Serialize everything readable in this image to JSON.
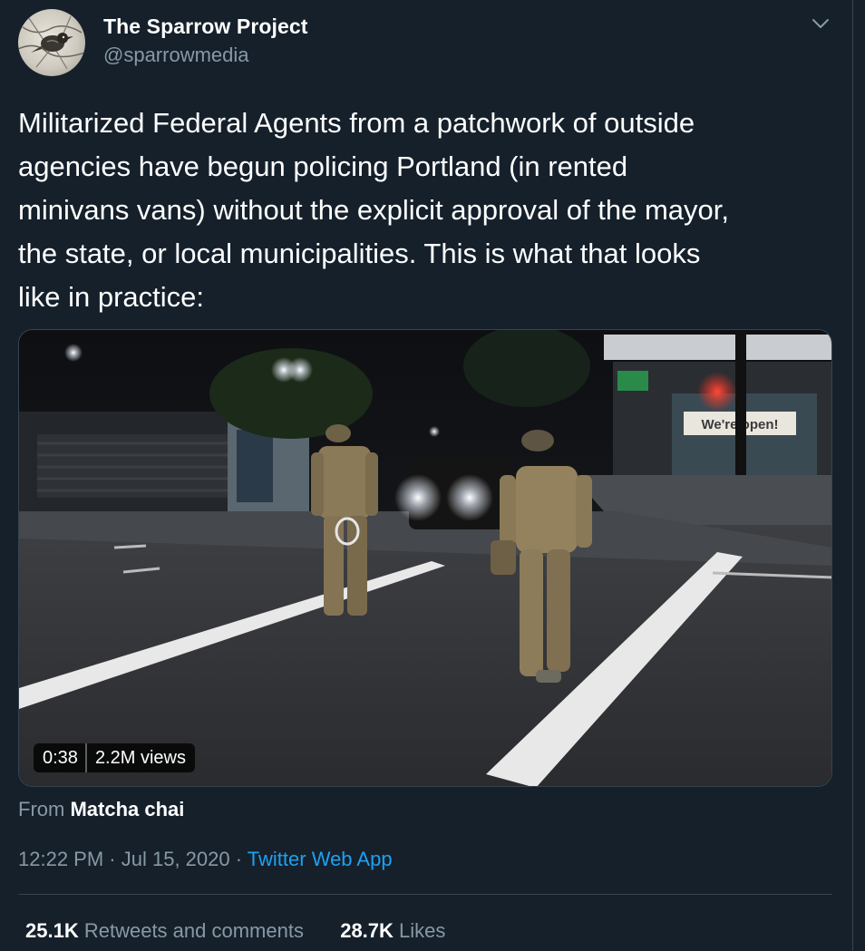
{
  "user": {
    "display_name": "The Sparrow Project",
    "handle": "@sparrowmedia"
  },
  "tweet": {
    "lines": [
      "Militarized Federal Agents from a patchwork of outside",
      "agencies have begun policing Portland (in rented",
      "minivans vans) without the explicit approval of the mayor,",
      "the state, or local municipalities. This is what that looks",
      "like in practice:"
    ]
  },
  "media": {
    "duration": "0:38",
    "views": "2.2M views",
    "store_sign": "We're open!"
  },
  "attribution": {
    "prefix": "From",
    "author": "Matcha chai"
  },
  "meta": {
    "time": "12:22 PM",
    "separator": "·",
    "date": "Jul 15, 2020",
    "source": "Twitter Web App"
  },
  "stats": {
    "retweets_count": "25.1K",
    "retweets_label": "Retweets and comments",
    "likes_count": "28.7K",
    "likes_label": "Likes"
  },
  "icons": {
    "more": "chevron-down-icon",
    "avatar": "sparrow-logo"
  },
  "colors": {
    "background": "#15202b",
    "secondary_text": "#8899a6",
    "link": "#1da1f2",
    "border": "#38444d"
  }
}
